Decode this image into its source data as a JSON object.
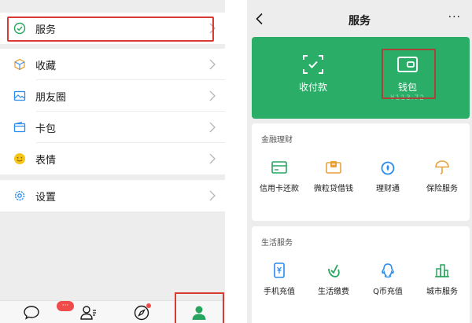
{
  "left_panel": {
    "menu": [
      {
        "key": "service",
        "label": "服务",
        "icon": "service-check-icon"
      },
      {
        "key": "favorites",
        "label": "收藏",
        "icon": "cube-icon"
      },
      {
        "key": "moments",
        "label": "朋友圈",
        "icon": "picture-icon"
      },
      {
        "key": "cards",
        "label": "卡包",
        "icon": "card-wallet-icon"
      },
      {
        "key": "stickers",
        "label": "表情",
        "icon": "smile-icon"
      },
      {
        "key": "settings",
        "label": "设置",
        "icon": "gear-icon"
      }
    ],
    "tabbar": {
      "chats_badge": "···",
      "tabs": [
        "chat-bubble-icon",
        "contacts-icon",
        "compass-icon",
        "person-icon"
      ],
      "active_tab": "me"
    }
  },
  "right_panel": {
    "title": "服务",
    "more": "···",
    "header_items": [
      {
        "label": "收付款",
        "icon": "qr-scan-icon"
      },
      {
        "label": "钱包",
        "icon": "wallet-icon",
        "balance": "¥113.72"
      }
    ],
    "finance": {
      "title": "金融理财",
      "items": [
        {
          "label": "信用卡还款",
          "icon": "credit-card-icon"
        },
        {
          "label": "微粒贷借钱",
          "icon": "loan-icon"
        },
        {
          "label": "理财通",
          "icon": "drop-icon"
        },
        {
          "label": "保险服务",
          "icon": "umbrella-icon"
        }
      ]
    },
    "life": {
      "title": "生活服务",
      "items": [
        {
          "label": "手机充值",
          "icon": "phone-yuan-icon"
        },
        {
          "label": "生活缴费",
          "icon": "leaf-check-icon"
        },
        {
          "label": "Q币充值",
          "icon": "penguin-icon"
        },
        {
          "label": "城市服务",
          "icon": "city-icon"
        }
      ]
    }
  },
  "colors": {
    "accent_green": "#2aae67",
    "highlight_red": "#d83a34",
    "finance_icon": "#27a55e",
    "gold_icon": "#e9a23b",
    "blue_icon": "#2a8cf0"
  }
}
